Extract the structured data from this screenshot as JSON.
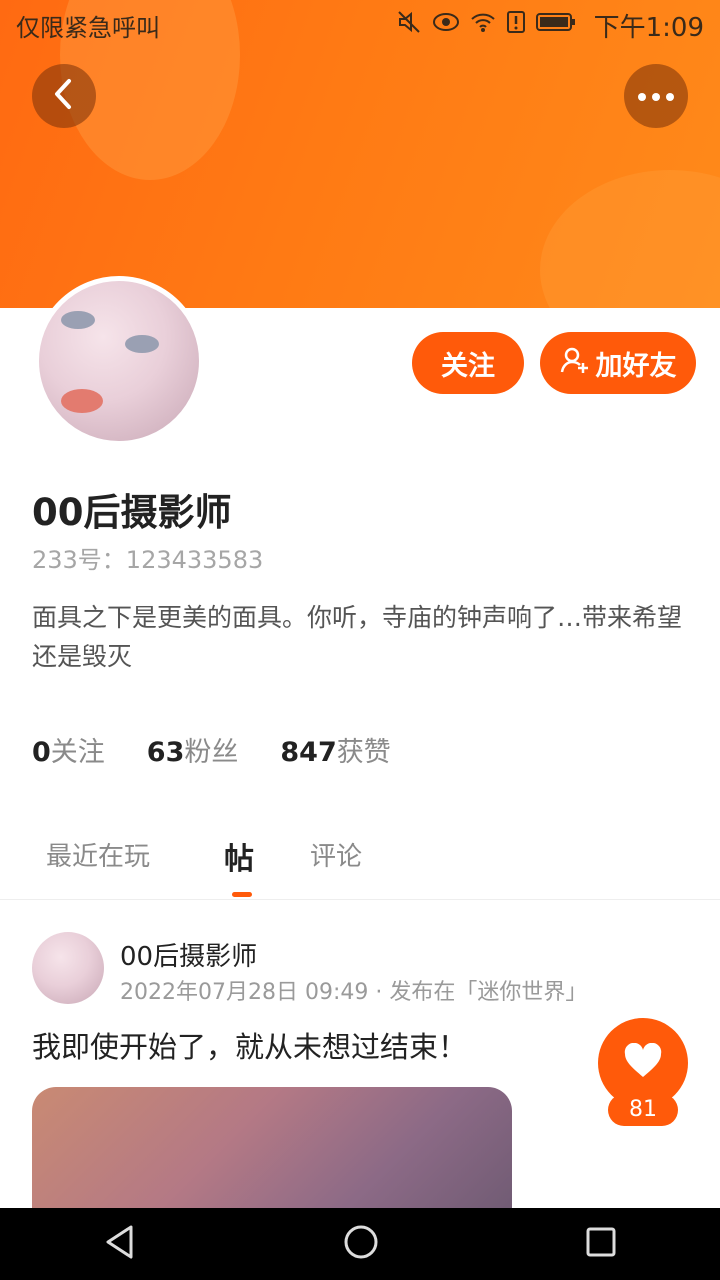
{
  "status_bar": {
    "carrier": "仅限紧急呼叫",
    "time": "下午1:09",
    "icons": [
      "mute-icon",
      "eye-icon",
      "wifi-icon",
      "alert-icon",
      "battery-icon"
    ]
  },
  "header": {
    "back_icon": "chevron-left-icon",
    "more_icon": "more-dots-icon",
    "accent_color": "#ff6a12"
  },
  "actions": {
    "follow_label": "关注",
    "add_friend_label": "加好友",
    "add_friend_icon": "add-user-icon",
    "button_color": "#ff5a0a"
  },
  "profile": {
    "name": "00后摄影师",
    "id_text": "233号：123433583",
    "bio": "面具之下是更美的面具。你听，寺庙的钟声响了…带来希望还是毁灭"
  },
  "stats": [
    {
      "num": "0",
      "label": "关注"
    },
    {
      "num": "63",
      "label": "粉丝"
    },
    {
      "num": "847",
      "label": "获赞"
    }
  ],
  "tabs": [
    {
      "label": "最近在玩"
    },
    {
      "label": "帖"
    },
    {
      "label": "评论"
    }
  ],
  "post": {
    "author": "00后摄影师",
    "meta": "2022年07月28日 09:49 · 发布在「迷你世界」",
    "text": "我即使开始了，就从未想过结束！",
    "like_count": "81"
  },
  "nav_bar": {
    "icons": [
      "back-triangle-icon",
      "home-circle-icon",
      "recents-square-icon"
    ]
  }
}
